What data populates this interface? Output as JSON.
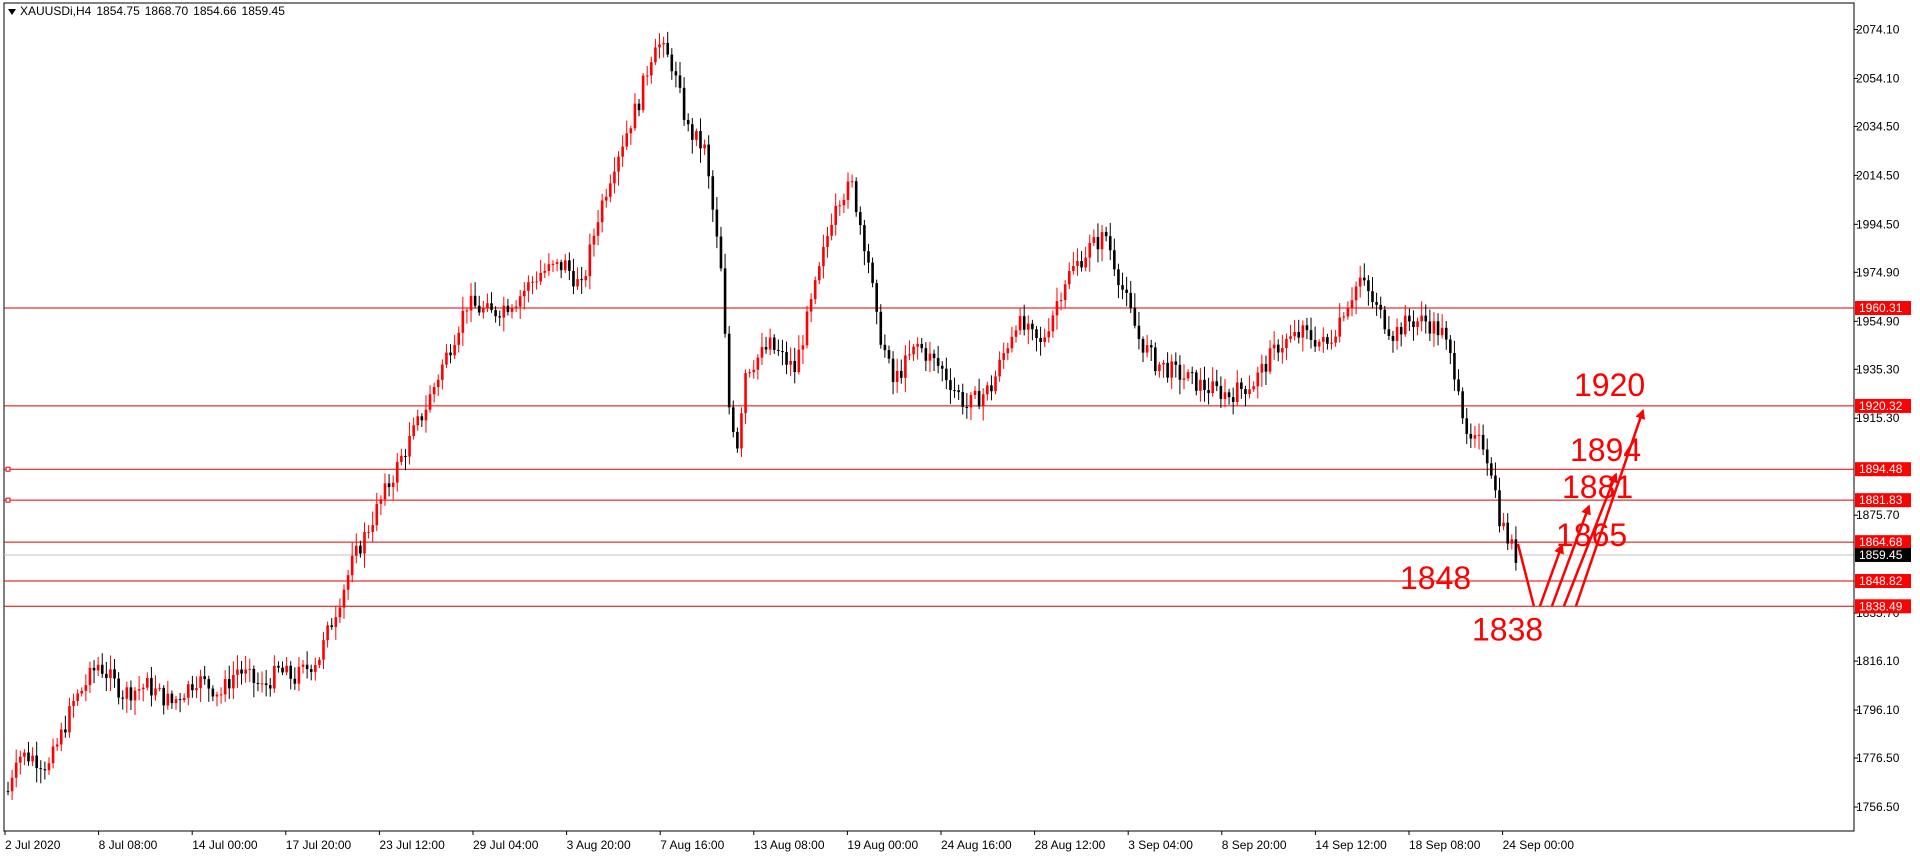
{
  "header": {
    "symbol": "XAUUSDi,H4",
    "open": "1854.75",
    "high": "1868.70",
    "low": "1854.66",
    "close": "1859.45"
  },
  "colors": {
    "bull": "#ff0000",
    "bear": "#000000",
    "level_line": "#e00000",
    "level_label_bg": "#ff0000",
    "current_label_bg": "#000000",
    "annotation": "#ff0000",
    "axis": "#000000",
    "current_line": "#c0c0c0"
  },
  "chart_data": {
    "type": "candlestick",
    "title": "XAUUSDi,H4",
    "ylim": [
      1746.7,
      2084.9
    ],
    "y_ticks": [
      "2074.10",
      "2054.10",
      "2034.50",
      "2014.50",
      "1994.50",
      "1974.90",
      "1954.90",
      "1935.30",
      "1915.30",
      "1875.70",
      "1835.70",
      "1816.10",
      "1796.10",
      "1776.50",
      "1756.50"
    ],
    "x_ticks": [
      "2 Jul 2020",
      "8 Jul 08:00",
      "14 Jul 00:00",
      "17 Jul 20:00",
      "23 Jul 12:00",
      "29 Jul 04:00",
      "3 Aug 20:00",
      "7 Aug 16:00",
      "13 Aug 08:00",
      "19 Aug 00:00",
      "24 Aug 16:00",
      "28 Aug 12:00",
      "3 Sep 04:00",
      "8 Sep 20:00",
      "14 Sep 12:00",
      "18 Sep 08:00",
      "24 Sep 00:00"
    ],
    "price_path": [
      [
        0,
        1763
      ],
      [
        2,
        1778
      ],
      [
        6,
        1777
      ],
      [
        10,
        1773
      ],
      [
        16,
        1799
      ],
      [
        22,
        1815
      ],
      [
        28,
        1803
      ],
      [
        34,
        1806
      ],
      [
        40,
        1799
      ],
      [
        46,
        1809
      ],
      [
        52,
        1803
      ],
      [
        56,
        1813
      ],
      [
        62,
        1805
      ],
      [
        66,
        1812
      ],
      [
        70,
        1809
      ],
      [
        76,
        1818
      ],
      [
        80,
        1837
      ],
      [
        84,
        1856
      ],
      [
        90,
        1878
      ],
      [
        96,
        1899
      ],
      [
        102,
        1920
      ],
      [
        108,
        1945
      ],
      [
        112,
        1962
      ],
      [
        118,
        1958
      ],
      [
        124,
        1964
      ],
      [
        130,
        1975
      ],
      [
        136,
        1978
      ],
      [
        140,
        1968
      ],
      [
        144,
        1998
      ],
      [
        148,
        2020
      ],
      [
        154,
        2045
      ],
      [
        158,
        2070
      ],
      [
        162,
        2060
      ],
      [
        166,
        2033
      ],
      [
        170,
        2025
      ],
      [
        174,
        1975
      ],
      [
        176,
        1920
      ],
      [
        178,
        1905
      ],
      [
        180,
        1935
      ],
      [
        186,
        1945
      ],
      [
        192,
        1935
      ],
      [
        198,
        1975
      ],
      [
        202,
        2005
      ],
      [
        206,
        2010
      ],
      [
        210,
        1980
      ],
      [
        212,
        1955
      ],
      [
        216,
        1930
      ],
      [
        222,
        1945
      ],
      [
        228,
        1935
      ],
      [
        234,
        1920
      ],
      [
        240,
        1928
      ],
      [
        246,
        1955
      ],
      [
        252,
        1945
      ],
      [
        258,
        1972
      ],
      [
        264,
        1985
      ],
      [
        268,
        1990
      ],
      [
        272,
        1968
      ],
      [
        276,
        1948
      ],
      [
        280,
        1938
      ],
      [
        286,
        1933
      ],
      [
        292,
        1928
      ],
      [
        298,
        1925
      ],
      [
        304,
        1930
      ],
      [
        310,
        1945
      ],
      [
        316,
        1950
      ],
      [
        322,
        1945
      ],
      [
        326,
        1960
      ],
      [
        330,
        1972
      ],
      [
        334,
        1960
      ],
      [
        338,
        1950
      ],
      [
        342,
        1955
      ],
      [
        346,
        1955
      ],
      [
        350,
        1950
      ],
      [
        354,
        1930
      ],
      [
        356,
        1905
      ],
      [
        360,
        1905
      ],
      [
        362,
        1895
      ],
      [
        364,
        1875
      ],
      [
        366,
        1866
      ],
      [
        368,
        1859
      ]
    ],
    "total_bars": 369,
    "levels": [
      {
        "value": 1960.31,
        "label": "1960.31"
      },
      {
        "value": 1920.32,
        "label": "1920.32"
      },
      {
        "value": 1894.48,
        "label": "1894.48"
      },
      {
        "value": 1881.83,
        "label": "1881.83"
      },
      {
        "value": 1864.68,
        "label": "1864.68"
      },
      {
        "value": 1848.82,
        "label": "1848.82"
      },
      {
        "value": 1838.49,
        "label": "1838.49"
      }
    ],
    "current_price": {
      "value": 1859.45,
      "label": "1859.45"
    },
    "annotations": [
      {
        "text": "1920"
      },
      {
        "text": "1894"
      },
      {
        "text": "1881"
      },
      {
        "text": "1865"
      },
      {
        "text": "1848"
      },
      {
        "text": "1838"
      }
    ],
    "grid": false
  }
}
